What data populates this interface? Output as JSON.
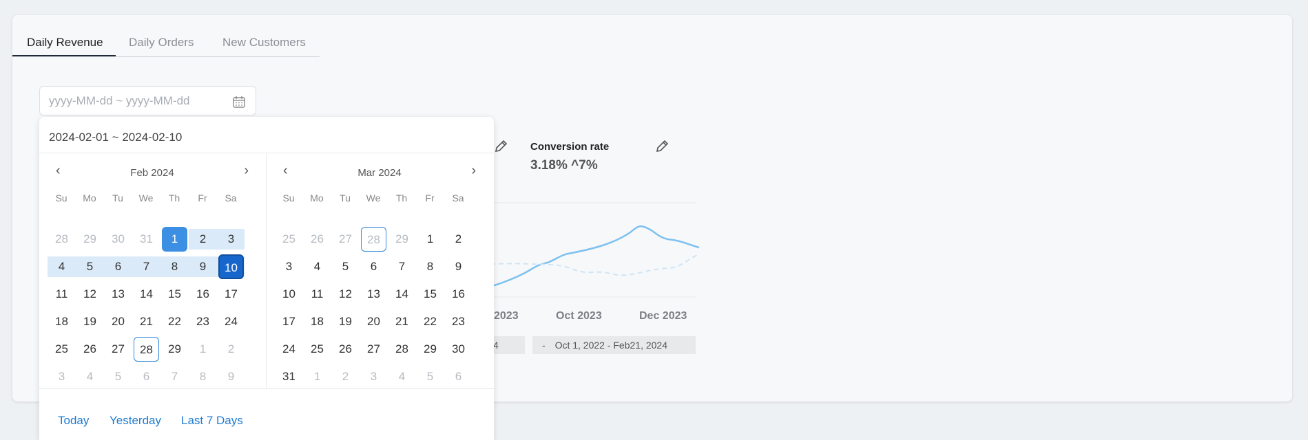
{
  "tabs": [
    {
      "label": "Daily Revenue"
    },
    {
      "label": "Daily Orders"
    },
    {
      "label": "New Customers"
    }
  ],
  "date_input": {
    "placeholder": "yyyy-MM-dd ~ yyyy-MM-dd",
    "icon": "calendar-icon"
  },
  "background": {
    "conversion_label": "Conversion rate",
    "conversion_value": "3.18% ^7%",
    "axis": [
      "2023",
      "Oct 2023",
      "Dec 2023"
    ],
    "range_left": "4",
    "range_right_dash": "-",
    "range_right": "Oct 1, 2022 - Feb21, 2024",
    "line_color": "#7cc1ef"
  },
  "popup": {
    "selected_range": "2024-02-01 ~ 2024-02-10",
    "weekdays": [
      "Su",
      "Mo",
      "Tu",
      "We",
      "Th",
      "Fr",
      "Sa"
    ],
    "left_month": {
      "title": "Feb 2024",
      "days": [
        [
          "28",
          "29",
          "30",
          "31",
          "1",
          "2",
          "3"
        ],
        [
          "4",
          "5",
          "6",
          "7",
          "8",
          "9",
          "10"
        ],
        [
          "11",
          "12",
          "13",
          "14",
          "15",
          "16",
          "17"
        ],
        [
          "18",
          "19",
          "20",
          "21",
          "22",
          "23",
          "24"
        ],
        [
          "25",
          "26",
          "27",
          "28",
          "29",
          "1",
          "2"
        ],
        [
          "3",
          "4",
          "5",
          "6",
          "7",
          "8",
          "9"
        ]
      ]
    },
    "right_month": {
      "title": "Mar 2024",
      "days": [
        [
          "25",
          "26",
          "27",
          "28",
          "29",
          "1",
          "2"
        ],
        [
          "3",
          "4",
          "5",
          "6",
          "7",
          "8",
          "9"
        ],
        [
          "10",
          "11",
          "12",
          "13",
          "14",
          "15",
          "16"
        ],
        [
          "17",
          "18",
          "19",
          "20",
          "21",
          "22",
          "23"
        ],
        [
          "24",
          "25",
          "26",
          "27",
          "28",
          "29",
          "30"
        ],
        [
          "31",
          "1",
          "2",
          "3",
          "4",
          "5",
          "6"
        ]
      ]
    },
    "shortcuts": [
      "Today",
      "Yesterday",
      "Last 7 Days"
    ],
    "accent": "#3d8fe3"
  }
}
